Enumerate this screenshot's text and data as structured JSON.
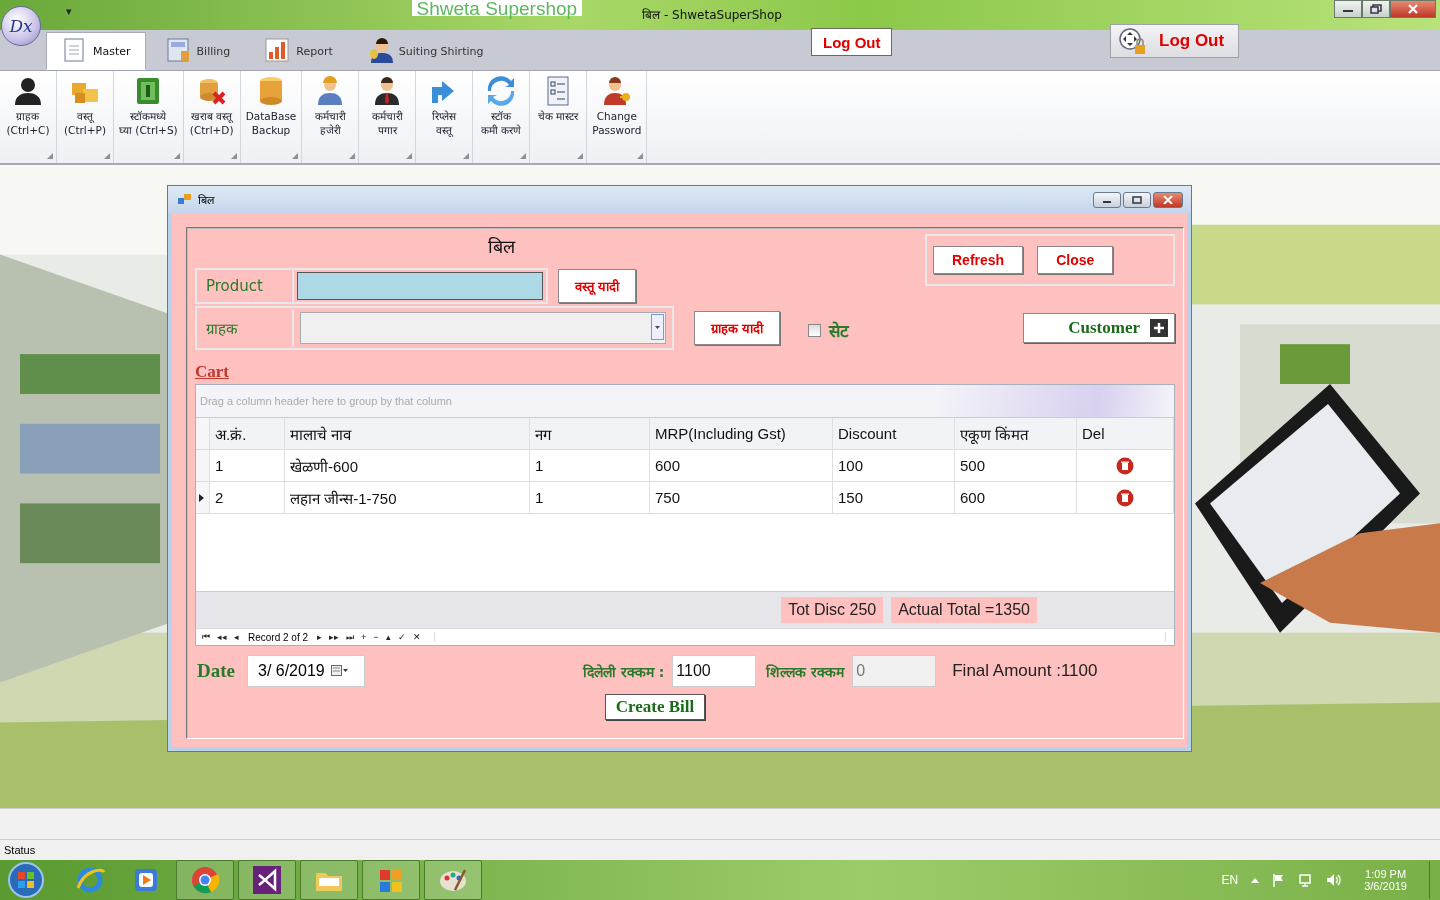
{
  "app": {
    "logo": "Dx",
    "quick_access": "▾",
    "brand": "Shweta Supershop",
    "title": "बिल - ShwetaSuperShop"
  },
  "ribbon": {
    "tabs": [
      {
        "label": "Master",
        "selected": true
      },
      {
        "label": "Billing",
        "selected": false
      },
      {
        "label": "Report",
        "selected": false
      },
      {
        "label": "Suiting Shirting",
        "selected": false
      }
    ],
    "logout": "Log Out",
    "logout_large": "Log Out",
    "commands": [
      {
        "label": "ग्राहक\n(Ctrl+C)"
      },
      {
        "label": "वस्तू\n(Ctrl+P)"
      },
      {
        "label": "स्टॉकमध्ये\nघ्या (Ctrl+S)"
      },
      {
        "label": "खराब वस्तू\n(Ctrl+D)"
      },
      {
        "label": "DataBase\nBackup"
      },
      {
        "label": "कर्मचारी\nहजेरी"
      },
      {
        "label": "कर्मचारी\nपगार"
      },
      {
        "label": "रिप्लेस\nवस्तू"
      },
      {
        "label": "स्टॉक\nकमी करणे"
      },
      {
        "label": "चेक मास्टर"
      },
      {
        "label": "Change\nPassword"
      }
    ]
  },
  "bill_window": {
    "title": "बिल",
    "heading": "बिल",
    "refresh": "Refresh",
    "close": "Close",
    "product_label": "Product",
    "product_list_button": "वस्तू यादी",
    "customer_label": "ग्राहक",
    "customer_list_button": "ग्राहक यादी",
    "set_checkbox": {
      "label": "सेट",
      "checked": false
    },
    "customer_button": "Customer",
    "cart_link": "Cart",
    "grid": {
      "group_hint": "Drag a column header here to group by that column",
      "columns": [
        "अ.क्रं.",
        "मालाचे नाव",
        "नग",
        "MRP(Including  Gst)",
        "Discount",
        "एकूण किंमत",
        "Del"
      ],
      "rows": [
        {
          "cells": [
            "1",
            "खेळणी-600",
            "1",
            "600",
            "100",
            "500"
          ],
          "current": false
        },
        {
          "cells": [
            "2",
            "लहान जीन्स-1-750",
            "1",
            "750",
            "150",
            "600"
          ],
          "current": true
        }
      ],
      "tot_disc": "Tot Disc  250",
      "actual_total": "Actual  Total  =1350",
      "navigator": {
        "record": "Record 2 of 2",
        "first": [
          "⏮",
          "◂◂",
          "◂"
        ],
        "last": [
          "▸",
          "▸▸",
          "⏭",
          "+",
          "−",
          "▴",
          "✓",
          "✕"
        ]
      }
    },
    "date_label": "Date",
    "date_value": "3/  6/2019",
    "paid_label": "दिलेली रक्कम :",
    "paid_value": "1100",
    "balance_label": "शिल्लक रक्कम",
    "balance_value": "0",
    "final_amount": "Final  Amount  :1100",
    "create_bill": "Create Bill"
  },
  "status_bar": "Status",
  "taskbar": {
    "language": "EN",
    "time": "1:09 PM",
    "date": "3/6/2019"
  }
}
